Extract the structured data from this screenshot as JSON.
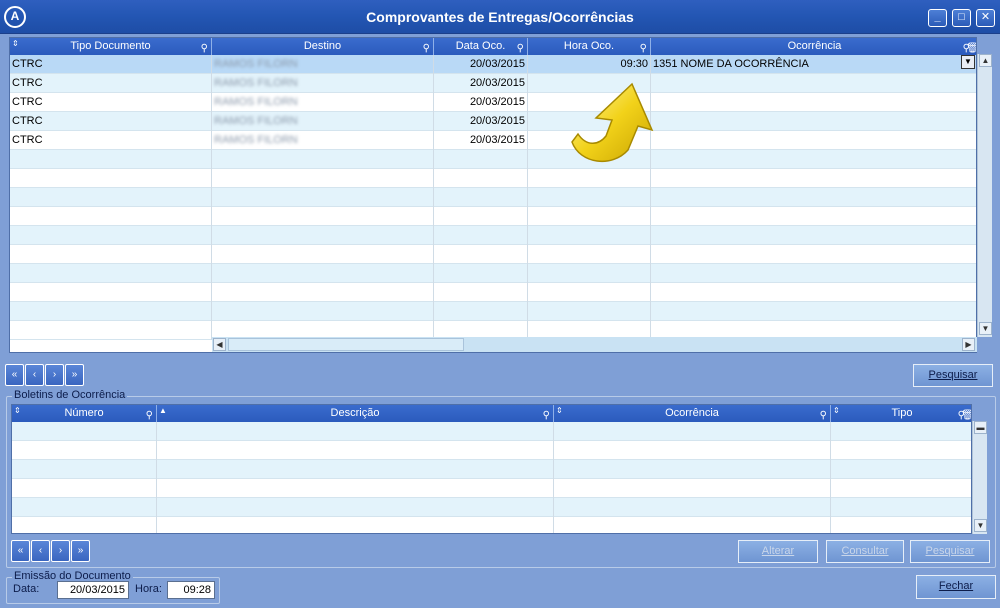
{
  "window": {
    "title": "Comprovantes de Entregas/Ocorrências",
    "logo_glyph": "A",
    "minimize_glyph": "_",
    "maximize_glyph": "□",
    "close_glyph": "✕"
  },
  "top_grid": {
    "columns": [
      "Tipo Documento",
      "Destino",
      "Data Oco.",
      "Hora Oco.",
      "Ocorrência"
    ],
    "rows": [
      {
        "tipo": "CTRC",
        "destino": "RAMOS FILORN",
        "data": "20/03/2015",
        "hora": "09:30",
        "ocorrencia": "1351 NOME DA OCORRÊNCIA"
      },
      {
        "tipo": "CTRC",
        "destino": "RAMOS FILORN",
        "data": "20/03/2015",
        "hora": "",
        "ocorrencia": ""
      },
      {
        "tipo": "CTRC",
        "destino": "RAMOS FILORN",
        "data": "20/03/2015",
        "hora": "",
        "ocorrencia": ""
      },
      {
        "tipo": "CTRC",
        "destino": "RAMOS FILORN",
        "data": "20/03/2015",
        "hora": "",
        "ocorrencia": ""
      },
      {
        "tipo": "CTRC",
        "destino": "RAMOS FILORN",
        "data": "20/03/2015",
        "hora": "",
        "ocorrencia": ""
      }
    ],
    "pesquisar_label": "Pesquisar"
  },
  "nav_glyphs": {
    "first": "«",
    "prev": "‹",
    "next": "›",
    "last": "»"
  },
  "boletins": {
    "group_label": "Boletins de Ocorrência",
    "columns": [
      "Número",
      "Descrição",
      "Ocorrência",
      "Tipo"
    ],
    "alterar_label": "Alterar",
    "consultar_label": "Consultar",
    "pesquisar_label": "Pesquisar"
  },
  "emissao": {
    "group_label": "Emissão do Documento",
    "data_label": "Data:",
    "data_value": "20/03/2015",
    "hora_label": "Hora:",
    "hora_value": "09:28"
  },
  "fechar_label": "Fechar",
  "colors": {
    "title_bar": "#2356b3",
    "grid_header": "#2b5bbd",
    "row_alt": "#e3f3fb",
    "row_selected": "#b9d9f6",
    "arrow": "#f2d21a"
  }
}
